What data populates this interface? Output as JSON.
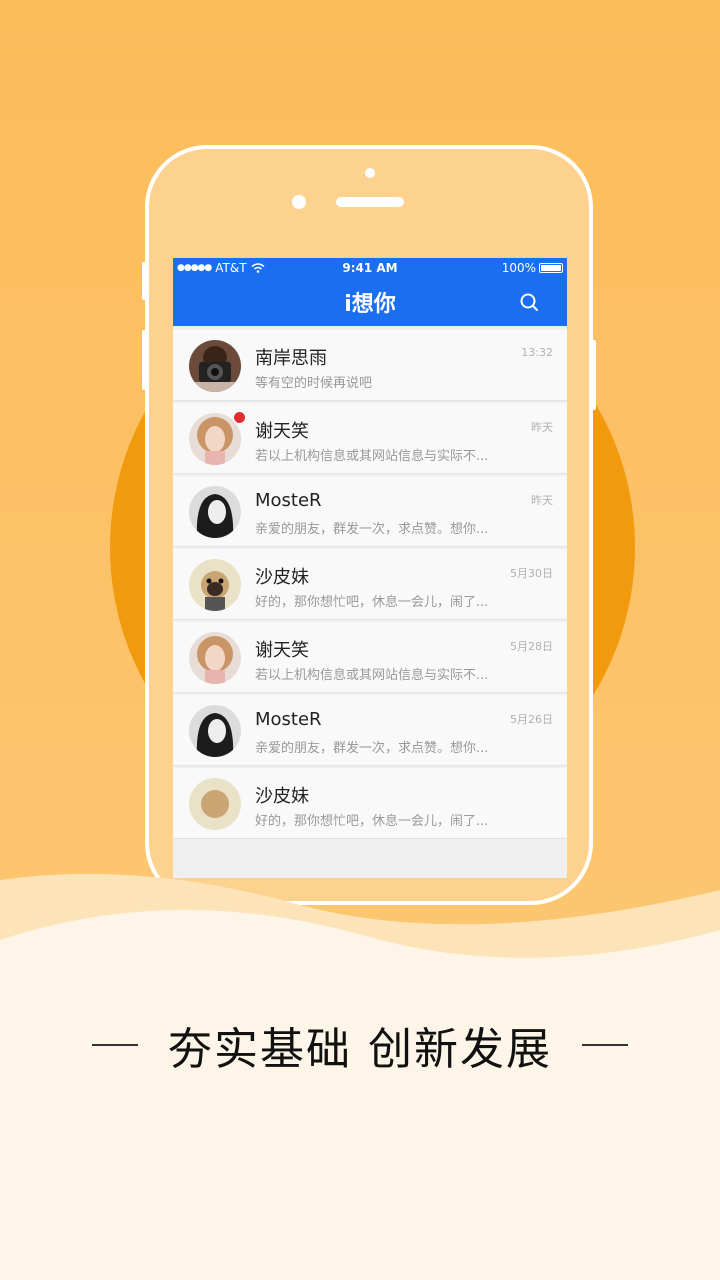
{
  "status_bar": {
    "carrier": "AT&T",
    "time": "9:41 AM",
    "battery": "100%"
  },
  "nav": {
    "title": "i想你",
    "search_icon": "search-icon"
  },
  "conversations": [
    {
      "name": "南岸思雨",
      "message": "等有空的时候再说吧",
      "time": "13:32",
      "unread": false,
      "avatar": "camera-girl"
    },
    {
      "name": "谢天笑",
      "message": "若以上机构信息或其网站信息与实际不...",
      "time": "昨天",
      "unread": true,
      "avatar": "blonde-girl"
    },
    {
      "name": "MosteR",
      "message": "亲爱的朋友，群发一次，求点赞。想你...",
      "time": "昨天",
      "unread": false,
      "avatar": "dark-hair-girl"
    },
    {
      "name": "沙皮妹",
      "message": "好的，那你想忙吧，休息一会儿，闹了...",
      "time": "5月30日",
      "unread": false,
      "avatar": "pug-dog"
    },
    {
      "name": "谢天笑",
      "message": "若以上机构信息或其网站信息与实际不...",
      "time": "5月28日",
      "unread": false,
      "avatar": "blonde-girl"
    },
    {
      "name": "MosteR",
      "message": "亲爱的朋友，群发一次，求点赞。想你...",
      "time": "5月26日",
      "unread": false,
      "avatar": "dark-hair-girl"
    },
    {
      "name": "沙皮妹",
      "message": "好的，那你想忙吧，休息一会儿，闹了...",
      "time": "",
      "unread": false,
      "avatar": "pug-dog"
    }
  ],
  "slogan": "夯实基础  创新发展",
  "colors": {
    "background": "#fdbe5d",
    "accent_circle": "#f29a0e",
    "nav_blue": "#1a6ff0",
    "unread_badge": "#e02e2e"
  }
}
